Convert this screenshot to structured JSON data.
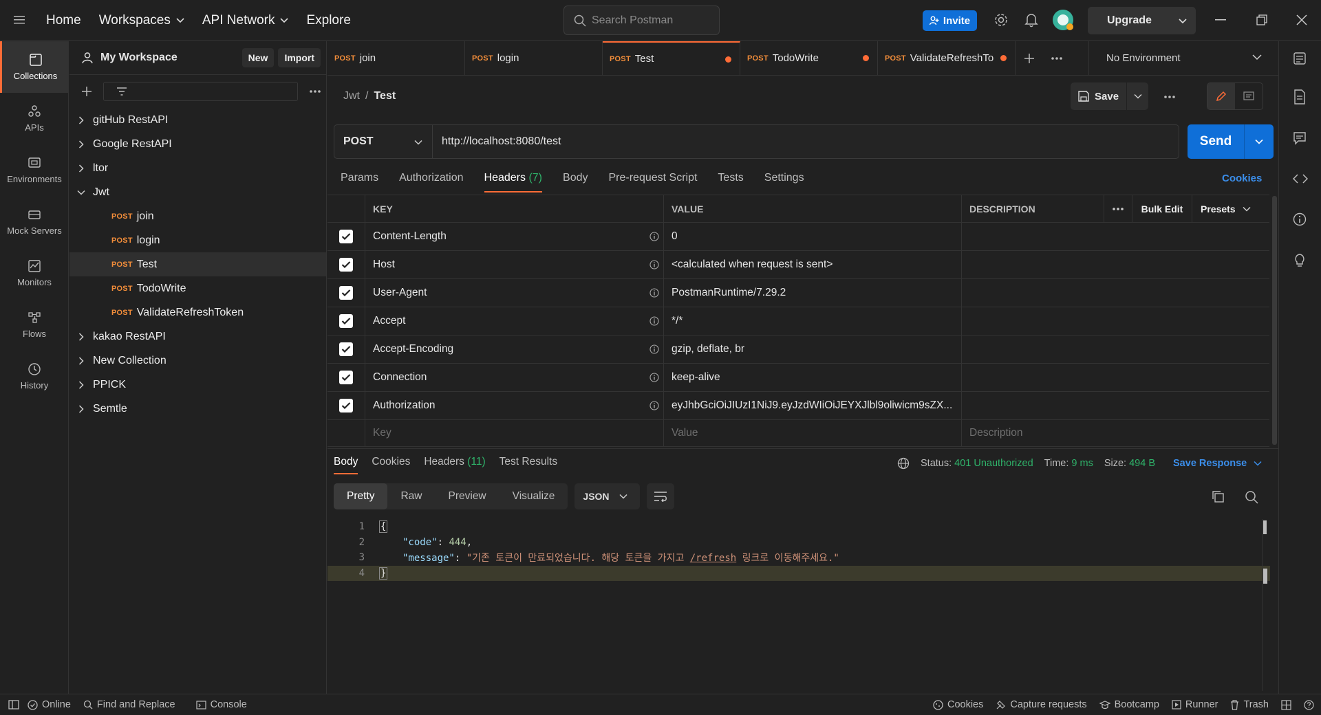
{
  "topbar": {
    "nav": {
      "home": "Home",
      "workspaces": "Workspaces",
      "api_network": "API Network",
      "explore": "Explore"
    },
    "search_placeholder": "Search Postman",
    "invite": "Invite",
    "upgrade": "Upgrade"
  },
  "rail": [
    {
      "label": "Collections",
      "icon": "collections-icon"
    },
    {
      "label": "APIs",
      "icon": "apis-icon"
    },
    {
      "label": "Environments",
      "icon": "environments-icon"
    },
    {
      "label": "Mock Servers",
      "icon": "mock-servers-icon"
    },
    {
      "label": "Monitors",
      "icon": "monitors-icon"
    },
    {
      "label": "Flows",
      "icon": "flows-icon"
    },
    {
      "label": "History",
      "icon": "history-icon"
    }
  ],
  "workspace": {
    "title": "My Workspace",
    "new_label": "New",
    "import_label": "Import",
    "collections": [
      "gitHub RestAPI",
      "Google RestAPI",
      "ltor",
      "Jwt",
      "kakao RestAPI",
      "New Collection",
      "PPICK",
      "Semtle"
    ],
    "jwt_requests": [
      {
        "method": "POST",
        "name": "join"
      },
      {
        "method": "POST",
        "name": "login"
      },
      {
        "method": "POST",
        "name": "Test"
      },
      {
        "method": "POST",
        "name": "TodoWrite"
      },
      {
        "method": "POST",
        "name": "ValidateRefreshToken"
      }
    ]
  },
  "tabs": [
    {
      "method": "POST",
      "name": "join",
      "unsaved": false
    },
    {
      "method": "POST",
      "name": "login",
      "unsaved": false
    },
    {
      "method": "POST",
      "name": "Test",
      "unsaved": true
    },
    {
      "method": "POST",
      "name": "TodoWrite",
      "unsaved": true
    },
    {
      "method": "POST",
      "name": "ValidateRefreshTo",
      "unsaved": true
    }
  ],
  "environment": "No Environment",
  "request": {
    "breadcrumb_parent": "Jwt",
    "breadcrumb_sep": "/",
    "breadcrumb_current": "Test",
    "save_label": "Save",
    "method": "POST",
    "url": "http://localhost:8080/test",
    "send_label": "Send",
    "tabs": {
      "params": "Params",
      "authorization": "Authorization",
      "headers": "Headers",
      "headers_count": "(7)",
      "body": "Body",
      "prerequest": "Pre-request Script",
      "tests": "Tests",
      "settings": "Settings"
    },
    "cookies_link": "Cookies"
  },
  "headers_table": {
    "col_key": "KEY",
    "col_value": "VALUE",
    "col_desc": "DESCRIPTION",
    "bulk_edit": "Bulk Edit",
    "presets": "Presets",
    "rows": [
      {
        "key": "Content-Length",
        "value": "0"
      },
      {
        "key": "Host",
        "value": "<calculated when request is sent>"
      },
      {
        "key": "User-Agent",
        "value": "PostmanRuntime/7.29.2"
      },
      {
        "key": "Accept",
        "value": "*/*"
      },
      {
        "key": "Accept-Encoding",
        "value": "gzip, deflate, br"
      },
      {
        "key": "Connection",
        "value": "keep-alive"
      },
      {
        "key": "Authorization",
        "value": "eyJhbGciOiJIUzI1NiJ9.eyJzdWIiOiJEYXJlbl9oliwicm9sZX..."
      }
    ],
    "placeholder_key": "Key",
    "placeholder_value": "Value",
    "placeholder_desc": "Description"
  },
  "response": {
    "tabs": {
      "body": "Body",
      "cookies": "Cookies",
      "headers": "Headers",
      "headers_count": "(11)",
      "test_results": "Test Results"
    },
    "status_label": "Status:",
    "status_value": "401 Unauthorized",
    "time_label": "Time:",
    "time_value": "9 ms",
    "size_label": "Size:",
    "size_value": "494 B",
    "save_response": "Save Response",
    "views": {
      "pretty": "Pretty",
      "raw": "Raw",
      "preview": "Preview",
      "visualize": "Visualize"
    },
    "format": "JSON",
    "code": {
      "line_numbers": [
        "1",
        "2",
        "3",
        "4"
      ],
      "open_brace": "{",
      "code_key": "\"code\"",
      "code_value": "444",
      "message_key": "\"message\"",
      "message_value_pre": "\"기존 토큰이 만료되었습니다. 해당 토큰을 가지고 ",
      "message_value_link": "/refresh",
      "message_value_post": " 링크로 이동해주세요.\"",
      "close_brace": "}"
    }
  },
  "statusbar": {
    "online": "Online",
    "find_replace": "Find and Replace",
    "console": "Console",
    "cookies": "Cookies",
    "capture": "Capture requests",
    "bootcamp": "Bootcamp",
    "runner": "Runner",
    "trash": "Trash"
  },
  "colors": {
    "accent": "#ff6c37",
    "primary": "#0f6fd8",
    "success": "#2fb36a",
    "post": "#f28d3a"
  }
}
